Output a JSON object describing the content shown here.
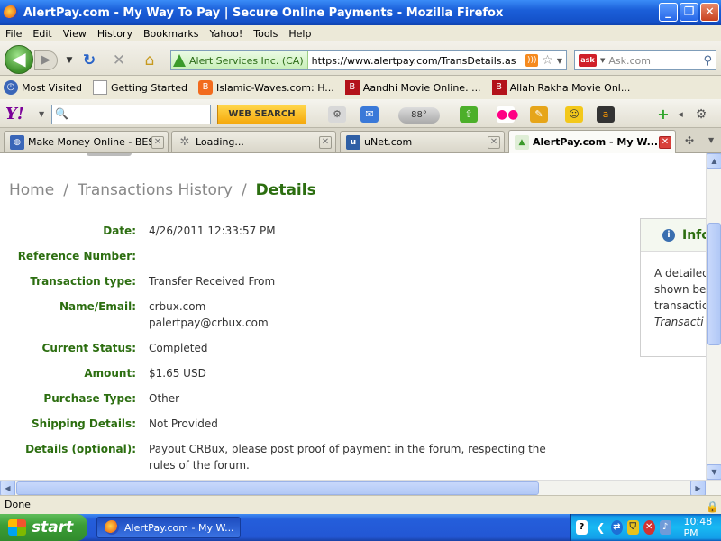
{
  "window": {
    "title": "AlertPay.com - My Way To Pay | Secure Online Payments - Mozilla Firefox"
  },
  "menu": [
    "File",
    "Edit",
    "View",
    "History",
    "Bookmarks",
    "Yahoo!",
    "Tools",
    "Help"
  ],
  "nav": {
    "identity": "Alert Services Inc. (CA)",
    "url": "https://www.alertpay.com/TransDetails.aspx?A",
    "search_placeholder": "Ask.com",
    "search_badge": "ask"
  },
  "bookmarks": [
    {
      "label": "Most Visited"
    },
    {
      "label": "Getting Started"
    },
    {
      "label": "Islamic-Waves.com: H..."
    },
    {
      "label": "Aandhi Movie Online. ..."
    },
    {
      "label": "Allah Rakha Movie Onl..."
    }
  ],
  "yahoo": {
    "logo": "Y!",
    "web_search": "WEB SEARCH",
    "weather": "88°"
  },
  "tabs": [
    {
      "label": "Make Money Online - BES...",
      "active": false
    },
    {
      "label": "Loading...",
      "active": false
    },
    {
      "label": "uNet.com",
      "active": false
    },
    {
      "label": "AlertPay.com - My W...",
      "active": true
    }
  ],
  "breadcrumb": {
    "home": "Home",
    "history": "Transactions History",
    "current": "Details",
    "separator": "/"
  },
  "details": [
    {
      "label": "Date:",
      "value": "4/26/2011 12:33:57 PM"
    },
    {
      "label": "Reference Number:",
      "value": ""
    },
    {
      "label": "Transaction type:",
      "value": "Transfer Received From"
    },
    {
      "label": "Name/Email:",
      "value": "crbux.com",
      "value2": "palertpay@crbux.com"
    },
    {
      "label": "Current Status:",
      "value": "Completed"
    },
    {
      "label": "Amount:",
      "value": "$1.65 USD"
    },
    {
      "label": "Purchase Type:",
      "value": "Other"
    },
    {
      "label": "Shipping Details:",
      "value": "Not Provided"
    },
    {
      "label": "Details (optional):",
      "value": "Payout CRBux, please post proof of payment in the forum, respecting the",
      "value2": "rules of the forum."
    }
  ],
  "info": {
    "title": "Info",
    "line1": "A detailed",
    "line2": "shown bel",
    "line3": "transactic",
    "line4": "Transacti"
  },
  "status": "Done",
  "taskbar": {
    "start": "start",
    "item": "AlertPay.com - My W...",
    "clock": "10:48 PM"
  }
}
